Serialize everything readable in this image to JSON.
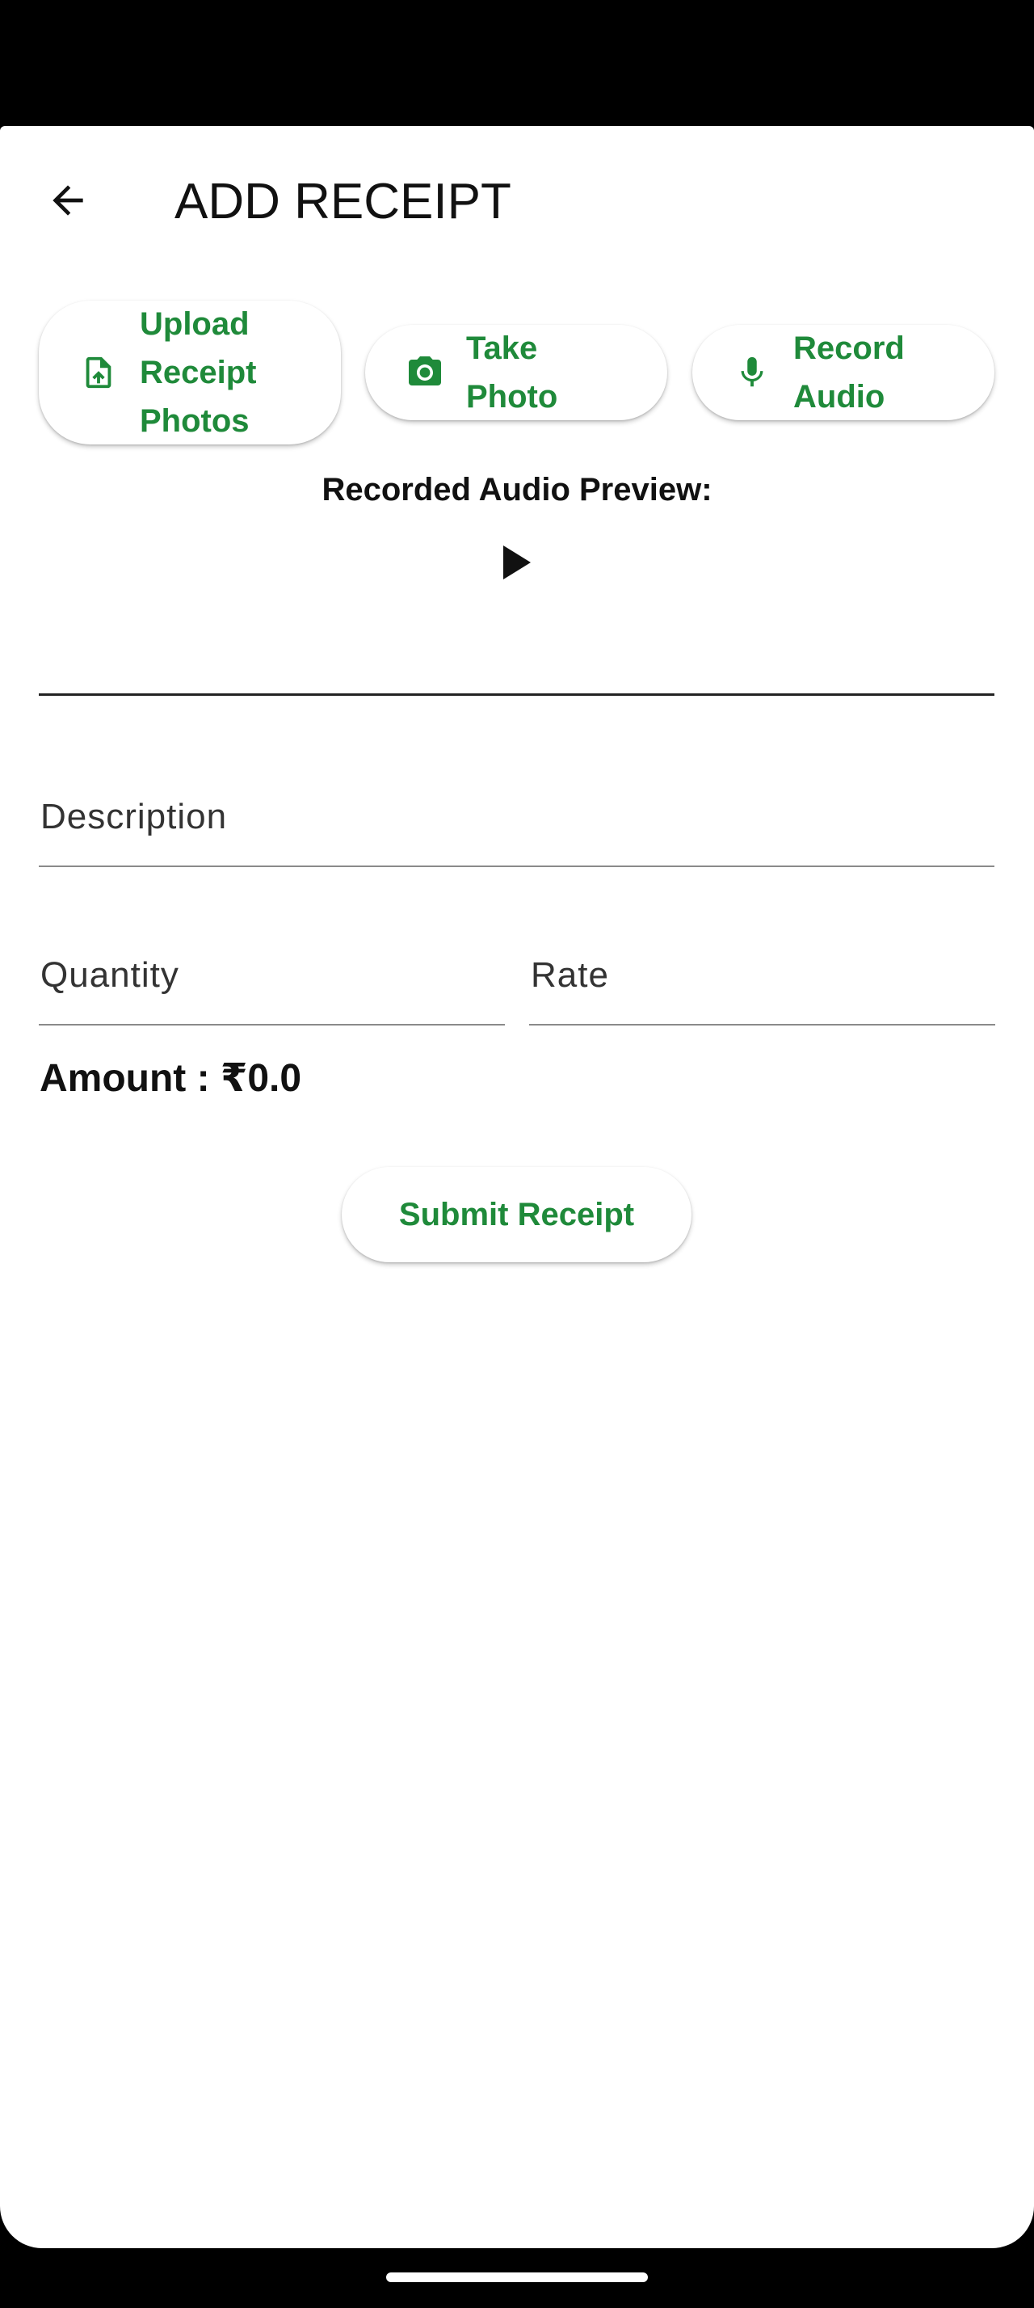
{
  "app_bar": {
    "title": "ADD RECEIPT",
    "back_icon": "arrow-back-icon"
  },
  "actions": {
    "upload": {
      "label": "Upload Receipt Photos",
      "icon": "file-upload-icon"
    },
    "photo": {
      "label": "Take Photo",
      "icon": "camera-icon"
    },
    "audio": {
      "label": "Record Audio",
      "icon": "microphone-icon"
    }
  },
  "audio_preview": {
    "title": "Recorded Audio Preview:",
    "play_icon": "play-icon"
  },
  "form": {
    "audio_field_value": "",
    "description_label": "Description",
    "quantity_label": "Quantity",
    "rate_label": "Rate",
    "amount_text": "Amount : ₹0.0"
  },
  "submit": {
    "label": "Submit Receipt"
  },
  "colors": {
    "accent": "#1f8a3a",
    "text": "#111111",
    "background": "#ffffff"
  }
}
